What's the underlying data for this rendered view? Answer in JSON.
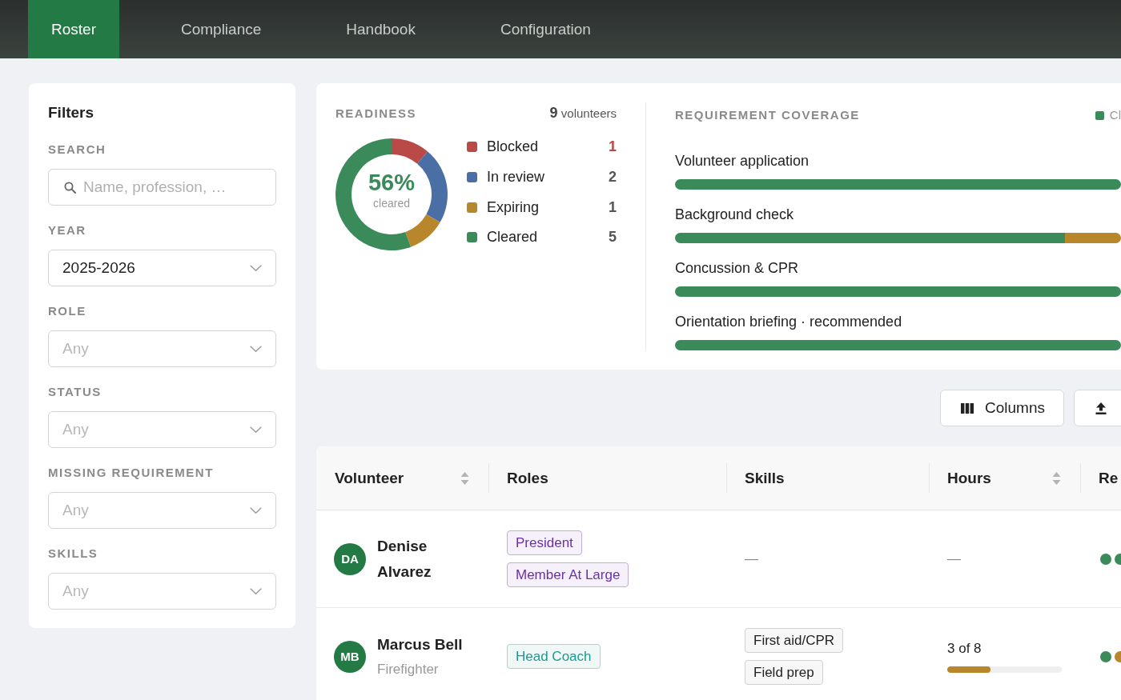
{
  "nav": {
    "tabs": [
      {
        "label": "Roster",
        "selected": true
      },
      {
        "label": "Compliance",
        "selected": false
      },
      {
        "label": "Handbook",
        "selected": false
      },
      {
        "label": "Configuration",
        "selected": false
      }
    ]
  },
  "filters": {
    "title": "Filters",
    "search": {
      "label": "SEARCH",
      "placeholder": "Name, profession, …"
    },
    "selects": [
      {
        "label": "YEAR",
        "value": "2025-2026"
      },
      {
        "label": "ROLE",
        "placeholder": "Any"
      },
      {
        "label": "STATUS",
        "placeholder": "Any"
      },
      {
        "label": "MISSING REQUIREMENT",
        "placeholder": "Any"
      },
      {
        "label": "SKILLS",
        "placeholder": "Any"
      }
    ]
  },
  "readiness": {
    "title": "READINESS",
    "total": "**9** volunteers",
    "center_value": "56%",
    "center_label": "cleared",
    "chart_data": {
      "type": "donut",
      "values": [
        11.1,
        22.2,
        11.1,
        55.6
      ]
    },
    "legend": [
      {
        "label": "Blocked",
        "count": "1",
        "color": "#b94a48",
        "alert": true
      },
      {
        "label": "In review",
        "count": "2",
        "color": "#4a6fa5",
        "alert": false
      },
      {
        "label": "Expiring",
        "count": "1",
        "color": "#b8862b",
        "alert": false
      },
      {
        "label": "Cleared",
        "count": "5",
        "color": "#3a8a5a",
        "alert": false
      }
    ]
  },
  "coverage": {
    "title": "REQUIREMENT COVERAGE",
    "legend": [
      {
        "label": "Cl",
        "color": "#3a8a5a"
      }
    ],
    "rows": [
      {
        "label": "Volunteer application",
        "segments": [
          {
            "color": "#3a8a5a",
            "level": 1
          }
        ]
      },
      {
        "label": "Background check",
        "segments": [
          {
            "color": "#3a8a5a",
            "level": 0.875
          },
          {
            "color": "#b8862b",
            "level": 0.125
          }
        ]
      },
      {
        "label": "Concussion & CPR",
        "segments": [
          {
            "color": "#3a8a5a",
            "level": 1
          }
        ]
      },
      {
        "label": "Orientation briefing · recommended",
        "segments": [
          {
            "color": "#3a8a5a",
            "level": 1
          }
        ]
      }
    ]
  },
  "toolbar": {
    "buttons": [
      {
        "kind": "columns",
        "label": "Columns"
      },
      {
        "kind": "upload"
      }
    ]
  },
  "table": {
    "columns": [
      {
        "label": "Volunteer",
        "sortable": true
      },
      {
        "label": "Roles",
        "sortable": false
      },
      {
        "label": "Skills",
        "sortable": false
      },
      {
        "label": "Hours",
        "sortable": true
      },
      {
        "label": "Re",
        "sortable": false
      }
    ],
    "rows": [
      {
        "initials": "DA",
        "name": "Denise Alvarez",
        "roles": [
          {
            "label": "President",
            "color": "#6b2fa8"
          },
          {
            "label": "Member At Large",
            "color": "#6b2fa8"
          }
        ],
        "skills": {
          "text": "—"
        },
        "hours": {
          "text": "—"
        },
        "status_dots": [
          {
            "color": "#3a8a5a"
          },
          {
            "color": "#3a8a5a"
          }
        ]
      },
      {
        "initials": "MB",
        "name": "Marcus Bell",
        "subtitle": "Firefighter",
        "roles": [
          {
            "label": "Head Coach",
            "color": "#1b9a90"
          }
        ],
        "skills": {
          "chips": [
            "First aid/CPR",
            "Field prep"
          ]
        },
        "hours": {
          "text": "3 of 8",
          "level": 0.375
        },
        "status_dots": [
          {
            "color": "#3a8a5a"
          },
          {
            "color": "#b8862b"
          }
        ]
      }
    ]
  }
}
